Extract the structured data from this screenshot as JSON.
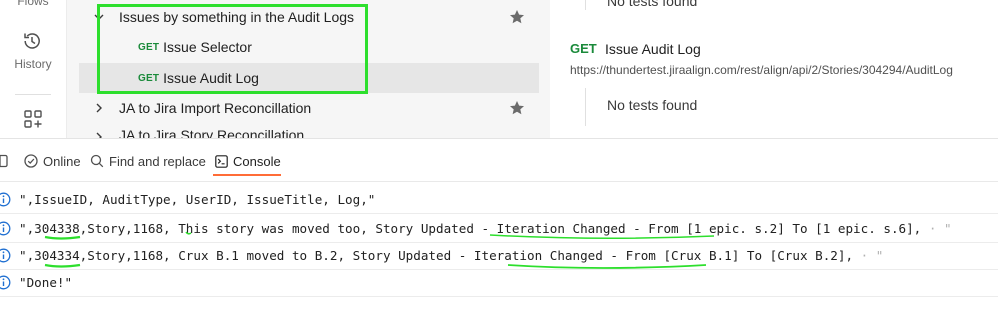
{
  "sidebar": {
    "flows_label": "Flows",
    "history_label": "History",
    "history_icon": "history-icon",
    "apis_icon": "apis-grid-icon"
  },
  "tree": {
    "folder_1": {
      "label": "Issues by something in the Audit Logs",
      "expanded": true,
      "starred": true
    },
    "requests": [
      {
        "method": "GET",
        "label": "Issue Selector"
      },
      {
        "method": "GET",
        "label": "Issue Audit Log",
        "selected": true
      }
    ],
    "folder_2": {
      "label": "JA to Jira Import Reconcillation",
      "expanded": false,
      "starred": true
    },
    "folder_3": {
      "label": "JA to Jira Story Reconcillation"
    }
  },
  "detail": {
    "top_text": "No tests found",
    "request_method": "GET",
    "request_name": "Issue Audit Log",
    "request_url": "https://thundertest.jiraalign.com/rest/align/api/2/Stories/304294/AuditLog",
    "no_tests": "No tests found"
  },
  "bottom_bar": {
    "online_label": "Online",
    "find_label": "Find and replace",
    "console_label": "Console"
  },
  "console": {
    "lines": [
      {
        "text": "\",IssueID, AuditType, UserID, IssueTitle, Log,\"",
        "trail": ""
      },
      {
        "text": "\",304338,Story,1168, This story was moved too, Story Updated - Iteration Changed - From [1 epic. s.2] To [1 epic. s.6],",
        "trail": " · \""
      },
      {
        "text": "\",304334,Story,1168, Crux B.1 moved to B.2, Story Updated - Iteration Changed - From [Crux B.1] To [Crux B.2],",
        "trail": " · \""
      },
      {
        "text": "\"Done!\"",
        "trail": ""
      }
    ]
  },
  "colors": {
    "get_method": "#1a8a3a",
    "highlight_box": "#2ddf2d",
    "console_tab_underline": "#ff6c37",
    "info_icon": "#1f6fd1"
  }
}
